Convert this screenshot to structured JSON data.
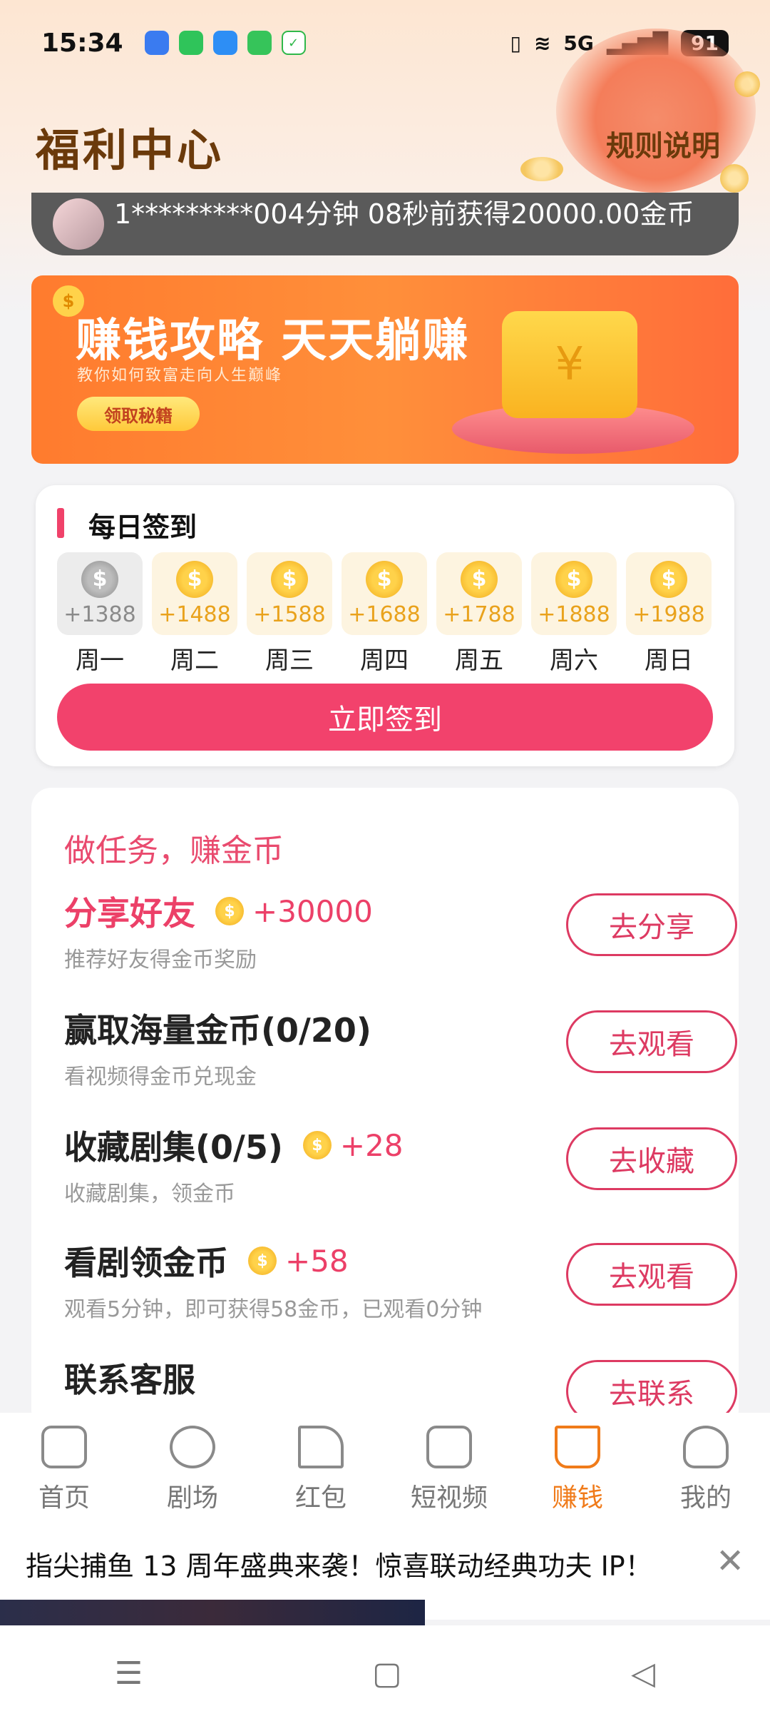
{
  "status_bar": {
    "time": "15:34",
    "signal": "5G",
    "battery": "91"
  },
  "header": {
    "title": "福利中心",
    "rules": "规则说明"
  },
  "ticker": {
    "text": "1*********004分钟 08秒前获得20000.00金币"
  },
  "banner": {
    "title": "赚钱攻略 天天躺赚",
    "subtitle": "教你如何致富走向人生巅峰",
    "button": "领取秘籍",
    "wallet_symbol": "¥"
  },
  "signin": {
    "title": "每日签到",
    "days": [
      {
        "amount": "+1388",
        "label": "周一",
        "done": true
      },
      {
        "amount": "+1488",
        "label": "周二",
        "done": false
      },
      {
        "amount": "+1588",
        "label": "周三",
        "done": false
      },
      {
        "amount": "+1688",
        "label": "周四",
        "done": false
      },
      {
        "amount": "+1788",
        "label": "周五",
        "done": false
      },
      {
        "amount": "+1888",
        "label": "周六",
        "done": false
      },
      {
        "amount": "+1988",
        "label": "周日",
        "done": false
      }
    ],
    "button": "立即签到"
  },
  "tasks": {
    "title": "做任务，赚金币",
    "items": [
      {
        "name": "分享好友",
        "reward": "+30000",
        "desc": "推荐好友得金币奖励",
        "button": "去分享"
      },
      {
        "name": "赢取海量金币(0/20)",
        "reward": "",
        "desc": "看视频得金币兑现金",
        "button": "去观看"
      },
      {
        "name": "收藏剧集(0/5)",
        "reward": "+28",
        "desc": "收藏剧集，领金币",
        "button": "去收藏"
      },
      {
        "name": "看剧领金币",
        "reward": "+58",
        "desc": "观看5分钟，即可获得58金币，已观看0分钟",
        "button": "去观看"
      },
      {
        "name": "联系客服",
        "reward": "",
        "desc": "",
        "button": "去联系"
      }
    ]
  },
  "bottom_nav": {
    "items": [
      {
        "label": "首页",
        "icon": "home-icon"
      },
      {
        "label": "剧场",
        "icon": "planet-icon"
      },
      {
        "label": "红包",
        "icon": "triangle-icon"
      },
      {
        "label": "短视频",
        "icon": "video-icon"
      },
      {
        "label": "赚钱",
        "icon": "cart-icon",
        "active": true
      },
      {
        "label": "我的",
        "icon": "user-icon"
      }
    ]
  },
  "ad": {
    "text": "指尖捕鱼 13 周年盛典来袭！惊喜联动经典功夫 IP！",
    "close": "✕"
  },
  "colors": {
    "accent": "#f2426c",
    "nav_active": "#f07b1a",
    "title_brown": "#6b3a0b"
  }
}
